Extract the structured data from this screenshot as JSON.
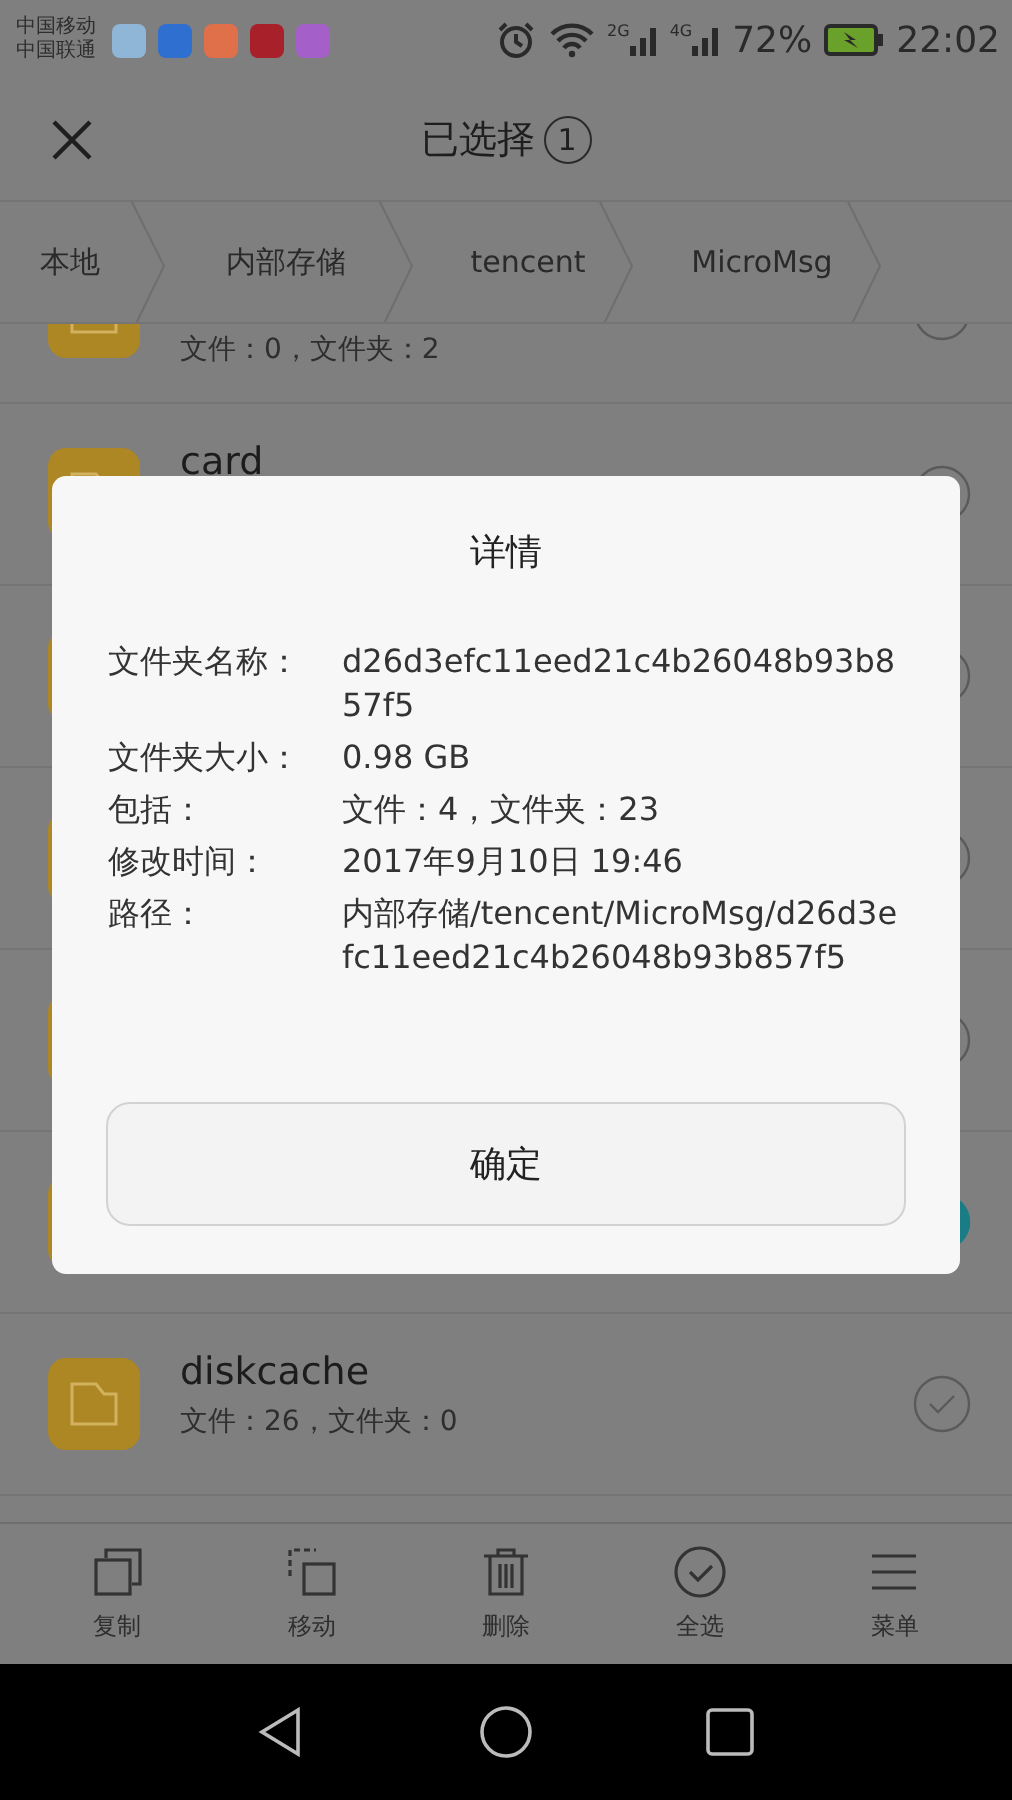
{
  "status_bar": {
    "carriers": [
      "中国移动",
      "中国联通"
    ],
    "app_icons": [
      {
        "color": "#8fb6d6"
      },
      {
        "color": "#2f6fd0"
      },
      {
        "color": "#e0704a"
      },
      {
        "color": "#a8202a"
      },
      {
        "color": "#a45fc8"
      }
    ],
    "networks": [
      "2G",
      "4G"
    ],
    "battery": "72%",
    "time": "22:02"
  },
  "header": {
    "title": "已选择",
    "count": "1"
  },
  "breadcrumb": [
    {
      "label": "本地"
    },
    {
      "label": "内部存储"
    },
    {
      "label": "tencent"
    },
    {
      "label": "MicroMsg"
    }
  ],
  "files": [
    {
      "info": "文件：0，文件夹：2",
      "selected": false
    },
    {
      "name": "card",
      "selected": false
    },
    {
      "selected": false
    },
    {
      "selected": false
    },
    {
      "selected": false
    },
    {
      "selected": true
    },
    {
      "name": "diskcache",
      "info": "文件：26，文件夹：0",
      "selected": false
    }
  ],
  "dialog": {
    "title": "详情",
    "rows": [
      {
        "label": "文件夹名称：",
        "value": "d26d3efc11eed21c4b26048b93b857f5"
      },
      {
        "label": "文件夹大小：",
        "value": "0.98 GB"
      },
      {
        "label": "包括：",
        "value": "文件：4，文件夹：23"
      },
      {
        "label": "修改时间：",
        "value": "2017年9月10日 19:46"
      },
      {
        "label": "路径：",
        "value": "内部存储/tencent/MicroMsg/d26d3efc11eed21c4b26048b93b857f5"
      }
    ],
    "button": "确定"
  },
  "toolbar": [
    {
      "kind": "copy",
      "label": "复制"
    },
    {
      "kind": "move",
      "label": "移动"
    },
    {
      "kind": "delete",
      "label": "删除"
    },
    {
      "kind": "select_all",
      "label": "全选"
    },
    {
      "kind": "menu",
      "label": "菜单"
    }
  ]
}
